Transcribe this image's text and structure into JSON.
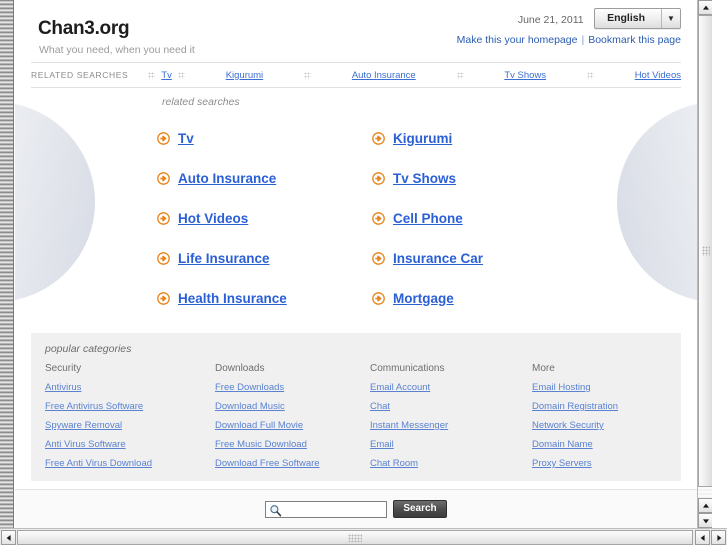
{
  "site": {
    "title": "Chan3.org",
    "tagline": "What you need, when you need it",
    "date": "June 21, 2011",
    "language": "English",
    "caret_glyph": "▼",
    "make_homepage": "Make this your homepage",
    "bookmark": "Bookmark this page",
    "link_separator": "|"
  },
  "related_strip": {
    "label": "RELATED SEARCHES",
    "items": [
      {
        "label": "Tv"
      },
      {
        "label": "Kigurumi"
      },
      {
        "label": "Auto Insurance"
      },
      {
        "label": "Tv Shows"
      },
      {
        "label": "Hot Videos"
      }
    ]
  },
  "main": {
    "heading": "related searches",
    "links": [
      {
        "label": "Tv"
      },
      {
        "label": "Kigurumi"
      },
      {
        "label": "Auto Insurance"
      },
      {
        "label": "Tv Shows"
      },
      {
        "label": "Hot Videos"
      },
      {
        "label": "Cell Phone"
      },
      {
        "label": "Life Insurance"
      },
      {
        "label": "Insurance Car"
      },
      {
        "label": "Health Insurance"
      },
      {
        "label": "Mortgage"
      }
    ]
  },
  "categories": {
    "heading": "popular categories",
    "columns": [
      {
        "title": "Security",
        "links": [
          "Antivirus",
          "Free Antivirus Software",
          "Spyware Removal",
          "Anti Virus Software",
          "Free Anti Virus Download"
        ]
      },
      {
        "title": "Downloads",
        "links": [
          "Free Downloads",
          "Download Music",
          "Download Full Movie",
          "Free Music Download",
          "Download Free Software"
        ]
      },
      {
        "title": "Communications",
        "links": [
          "Email Account",
          "Chat",
          "Instant Messenger",
          "Email",
          "Chat Room"
        ]
      },
      {
        "title": "More",
        "links": [
          "Email Hosting",
          "Domain Registration",
          "Network Security",
          "Domain Name",
          "Proxy Servers"
        ]
      }
    ]
  },
  "search": {
    "value": "",
    "placeholder": "",
    "button_label": "Search"
  },
  "colors": {
    "link_blue": "#2a5fd6",
    "strip_blue": "#3b6fd4",
    "category_blue": "#5b82d1",
    "arrow_orange": "#e8821a",
    "panel_gray": "#f0f0f0",
    "title_black": "#1d1d1d"
  }
}
